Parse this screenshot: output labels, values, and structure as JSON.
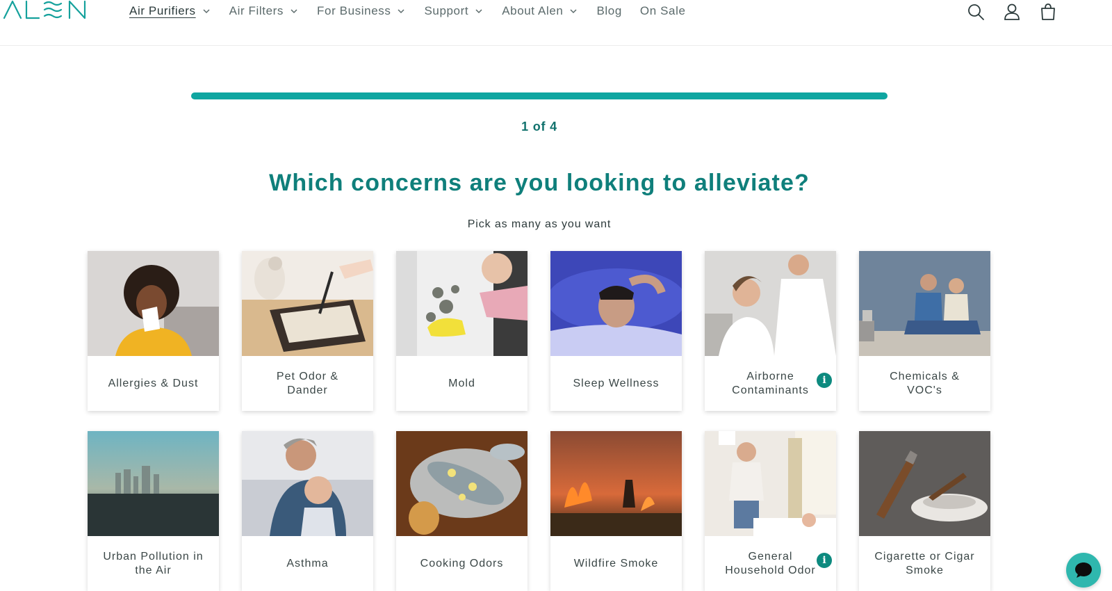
{
  "brand": {
    "logo_text": "ALEN",
    "accent": "#0fa6a1",
    "title_color": "#0f7f7b"
  },
  "nav": {
    "items": [
      {
        "label": "Air Purifiers",
        "dropdown": true,
        "active": true
      },
      {
        "label": "Air Filters",
        "dropdown": true
      },
      {
        "label": "For Business",
        "dropdown": true
      },
      {
        "label": "Support",
        "dropdown": true
      },
      {
        "label": "About Alen",
        "dropdown": true
      },
      {
        "label": "Blog",
        "dropdown": false
      },
      {
        "label": "On Sale",
        "dropdown": false
      }
    ]
  },
  "header_icons": [
    "search-icon",
    "account-icon",
    "cart-icon"
  ],
  "progress": {
    "current": 1,
    "total": 4,
    "fraction": 1.0,
    "label": "1 of 4"
  },
  "question": {
    "title": "Which concerns are you looking to alleviate?",
    "subtitle": "Pick as many as you want"
  },
  "options": [
    {
      "label": "Allergies & Dust",
      "info": false
    },
    {
      "label": "Pet Odor & Dander",
      "info": false
    },
    {
      "label": "Mold",
      "info": false
    },
    {
      "label": "Sleep Wellness",
      "info": false
    },
    {
      "label": "Airborne Contaminants",
      "info": true
    },
    {
      "label": "Chemicals & VOC's",
      "info": false
    },
    {
      "label": "Urban Pollution in the Air",
      "info": false
    },
    {
      "label": "Asthma",
      "info": false
    },
    {
      "label": "Cooking Odors",
      "info": false
    },
    {
      "label": "Wildfire Smoke",
      "info": false
    },
    {
      "label": "General Household Odor",
      "info": true
    },
    {
      "label": "Cigarette or Cigar Smoke",
      "info": false
    }
  ],
  "info_icon_glyph": "i",
  "chat": {
    "icon": "chat-bubble-icon",
    "color": "#2fb7ae"
  }
}
